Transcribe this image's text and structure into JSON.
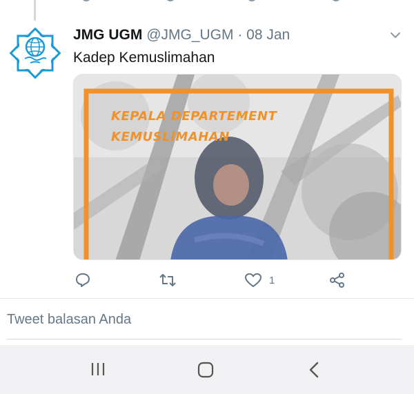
{
  "tweet": {
    "author_name": "JMG UGM",
    "handle_and_date": "@JMG_UGM · 08 Jan",
    "text": "Kadep Kemuslimahan",
    "image_title_line1": "KEPALA DEPARTEMENT",
    "image_title_line2": "KEMUSLIMAHAN",
    "like_count": "1"
  },
  "reply": {
    "placeholder": "Tweet balasan Anda"
  },
  "colors": {
    "accent_orange": "#f0922b",
    "icon_gray": "#657786",
    "avatar_blue": "#1b9ad6"
  },
  "icons": {
    "reply": "reply-icon",
    "retweet": "retweet-icon",
    "like": "heart-icon",
    "share": "share-icon",
    "more": "chevron-down-icon",
    "nav_recents": "recents-icon",
    "nav_home": "home-icon",
    "nav_back": "back-icon"
  }
}
